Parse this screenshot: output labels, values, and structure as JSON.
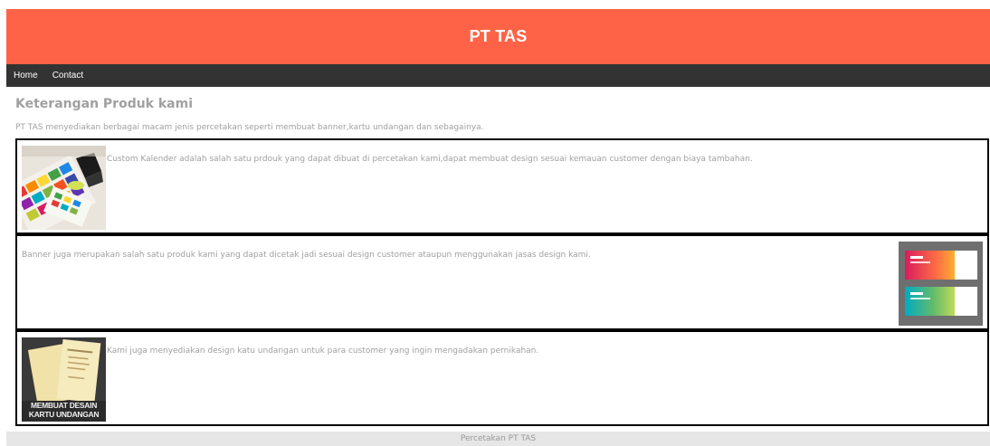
{
  "header": {
    "title": "PT TAS",
    "bg": "#ff6347"
  },
  "nav": {
    "items": [
      {
        "label": "Home"
      },
      {
        "label": "Contact"
      }
    ]
  },
  "main": {
    "heading": "Keterangan Produk kami",
    "intro": "PT TAS menyediakan berbagai macam jenis percetakan seperti membuat banner,kartu undangan dan sebagainya."
  },
  "products": [
    {
      "text": "Custom Kalender adalah salah satu prdouk yang dapat dibuat di percetakan kami,dapat membuat design sesuai kemauan customer dengan biaya tambahan.",
      "image": "calendar-image"
    },
    {
      "text": "Banner juga merupakan salah satu produk kami yang dapat dicetak jadi sesuai design customer ataupun menggunakan jasas design kami.",
      "image": "banner-image"
    },
    {
      "text": "Kami juga menyediakan design katu undangan untuk para customer yang ingin mengadakan pernikahan.",
      "image": "invitation-image",
      "image_caption": [
        "MEMBUAT DESAIN",
        "KARTU UNDANGAN"
      ]
    }
  ],
  "footer": {
    "text": "Percetakan PT TAS"
  }
}
